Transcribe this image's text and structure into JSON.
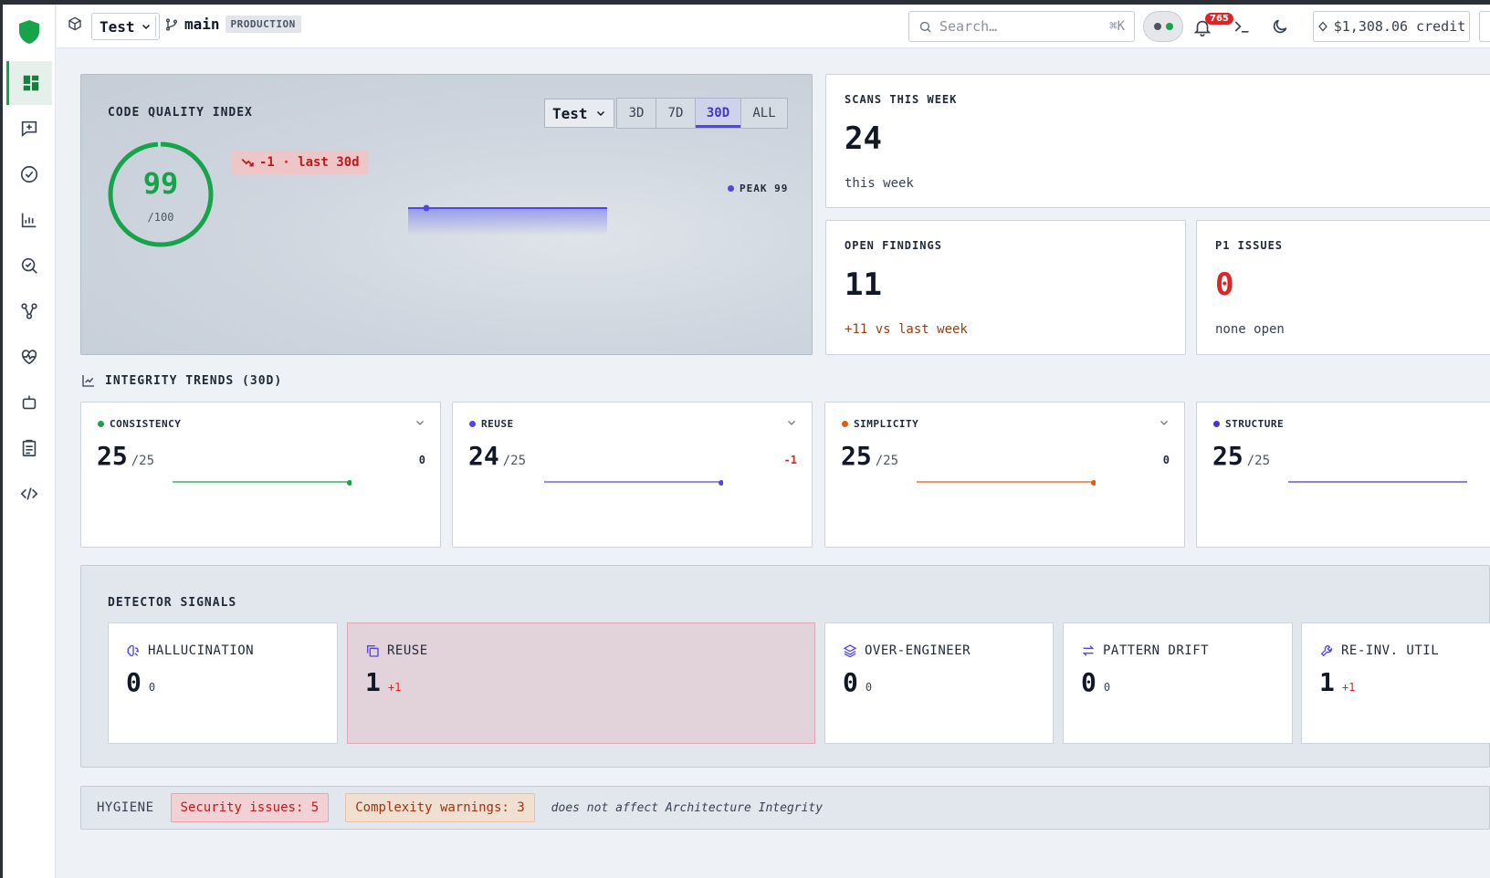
{
  "topbar": {
    "project": "Test",
    "branch": "main",
    "environment": "PRODUCTION",
    "search_placeholder": "Search…",
    "search_shortcut": "⌘K",
    "notification_count": "765",
    "credit": "$1,308.06 credit"
  },
  "quality": {
    "title": "CODE QUALITY INDEX",
    "score": "99",
    "score_denominator": "/100",
    "score_fraction": 0.99,
    "delta": "-1 · last 30d",
    "project_filter": "Test",
    "ranges": [
      "3D",
      "7D",
      "30D",
      "ALL"
    ],
    "active_range": "30D",
    "peak": "PEAK 99"
  },
  "stats": {
    "scans": {
      "title": "SCANS THIS WEEK",
      "value": "24",
      "sub": "this week"
    },
    "open_findings": {
      "title": "OPEN FINDINGS",
      "value": "11",
      "sub": "+11 vs last week"
    },
    "p1": {
      "title": "P1 ISSUES",
      "value": "0",
      "sub": "none open"
    }
  },
  "trends": {
    "title": "INTEGRITY TRENDS (30D)",
    "cards": [
      {
        "name": "CONSISTENCY",
        "value": "25",
        "den": "/25",
        "delta": "0",
        "color": "#16a34a"
      },
      {
        "name": "REUSE",
        "value": "24",
        "den": "/25",
        "delta": "-1",
        "color": "#4f46e5"
      },
      {
        "name": "SIMPLICITY",
        "value": "25",
        "den": "/25",
        "delta": "0",
        "color": "#ea580c"
      },
      {
        "name": "STRUCTURE",
        "value": "25",
        "den": "/25",
        "delta": "",
        "color": "#4338ca"
      }
    ]
  },
  "detectors": {
    "title": "DETECTOR SIGNALS",
    "cards": [
      {
        "name": "HALLUCINATION",
        "value": "0",
        "delta": "0",
        "icon": "brain-icon"
      },
      {
        "name": "REUSE",
        "value": "1",
        "delta": "+1",
        "icon": "copy-icon"
      },
      {
        "name": "OVER-ENGINEER",
        "value": "0",
        "delta": "0",
        "icon": "layers-icon"
      },
      {
        "name": "PATTERN DRIFT",
        "value": "0",
        "delta": "0",
        "icon": "arrows-icon"
      },
      {
        "name": "RE-INV. UTIL",
        "value": "1",
        "delta": "+1",
        "icon": "wrench-icon"
      }
    ]
  },
  "hygiene": {
    "label": "HYGIENE",
    "security": "Security issues: 5",
    "complexity": "Complexity warnings: 3",
    "note": "does not affect Architecture Integrity"
  },
  "colors": {
    "green": "#16a34a",
    "indigo": "#4f46e5",
    "red": "#dc2626",
    "orange": "#ea580c"
  }
}
